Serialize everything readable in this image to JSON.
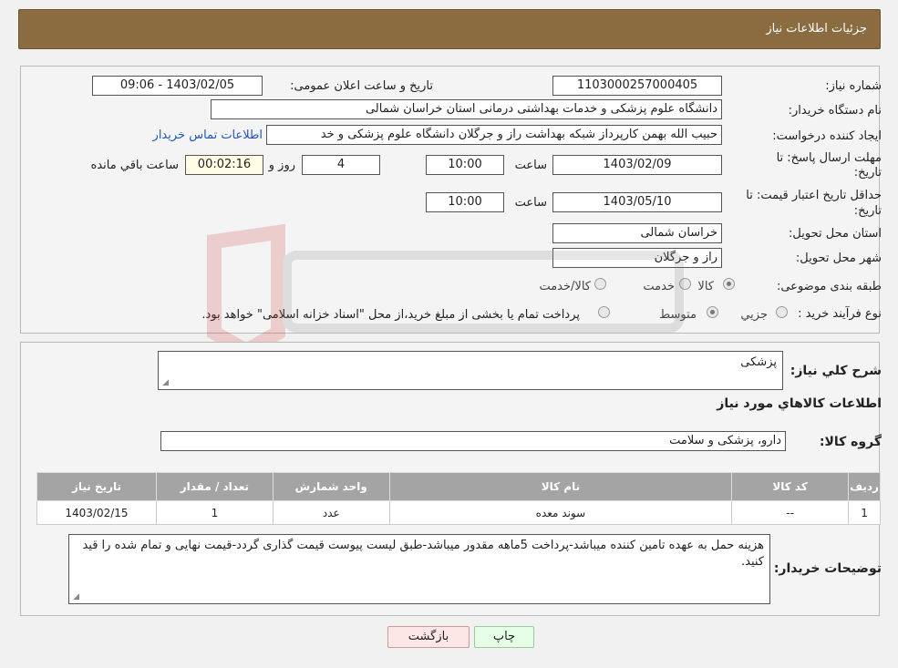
{
  "header": {
    "title": "جزئیات اطلاعات نیاز"
  },
  "fields": {
    "need_number_label": "شماره نیاز:",
    "need_number": "1103000257000405",
    "announce_label": "تاریخ و ساعت اعلان عمومی:",
    "announce_value": "1403/02/05 - 09:06",
    "buyer_label": "نام دستگاه خریدار:",
    "buyer_value": "دانشگاه علوم پزشکی و خدمات بهداشتی درمانی استان خراسان شمالی",
    "creator_label": "ایجاد کننده درخواست:",
    "creator_value": "حبیب الله بهمن کارپرداز شبکه بهداشت راز و جرگلان دانشگاه علوم پزشکی و خد",
    "contact_link": "اطلاعات تماس خریدار",
    "deadline_label_1": "مهلت ارسال پاسخ: تا",
    "deadline_label_2": "تاریخ:",
    "deadline_date": "1403/02/09",
    "time_label": "ساعت",
    "deadline_time": "10:00",
    "days_value": "4",
    "days_label": "روز و",
    "remaining_time": "00:02:16",
    "remaining_label": "ساعت باقي مانده",
    "validity_label_1": "حداقل تاریخ اعتبار قیمت: تا",
    "validity_label_2": "تاریخ:",
    "validity_date": "1403/05/10",
    "validity_time": "10:00",
    "province_label": "استان محل تحویل:",
    "province_value": "خراسان شمالی",
    "city_label": "شهر محل تحویل:",
    "city_value": "راز و جرگلان",
    "category_label": "طبقه بندی موضوعی:",
    "category_options": [
      "کالا",
      "خدمت",
      "کالا/خدمت"
    ],
    "process_label": "نوع فرآیند خرید :",
    "process_options": [
      "جزیي",
      "متوسط"
    ],
    "process_note": "پرداخت تمام یا بخشی از مبلغ خرید،از محل \"اسناد خزانه اسلامی\" خواهد بود."
  },
  "details": {
    "summary_label": "شرح کلي نياز:",
    "summary_value": "پزشکی",
    "goods_info_title": "اطلاعات كالاهاي مورد نياز",
    "group_label": "گروه کالا:",
    "group_value": "دارو، پزشکی و سلامت",
    "table": {
      "headers": [
        "ردیف",
        "کد کالا",
        "نام کالا",
        "واحد شمارش",
        "تعداد / مقدار",
        "تاریخ نیاز"
      ],
      "rows": [
        [
          "1",
          "--",
          "سوند معده",
          "عدد",
          "1",
          "1403/02/15"
        ]
      ]
    },
    "buyer_notes_label": "توضیحات خریدار:",
    "buyer_notes_value": "هزینه حمل به عهده تامین کننده میباشد-پرداخت 5ماهه مقدور میباشد-طبق لیست پیوست قیمت گذاری گردد-قیمت نهایی و تمام شده را قید کنید."
  },
  "buttons": {
    "print": "چاپ",
    "back": "بازگشت"
  },
  "colors": {
    "header": "#8b6b40",
    "table_header": "#a4a4a4",
    "link": "#2255bb"
  }
}
